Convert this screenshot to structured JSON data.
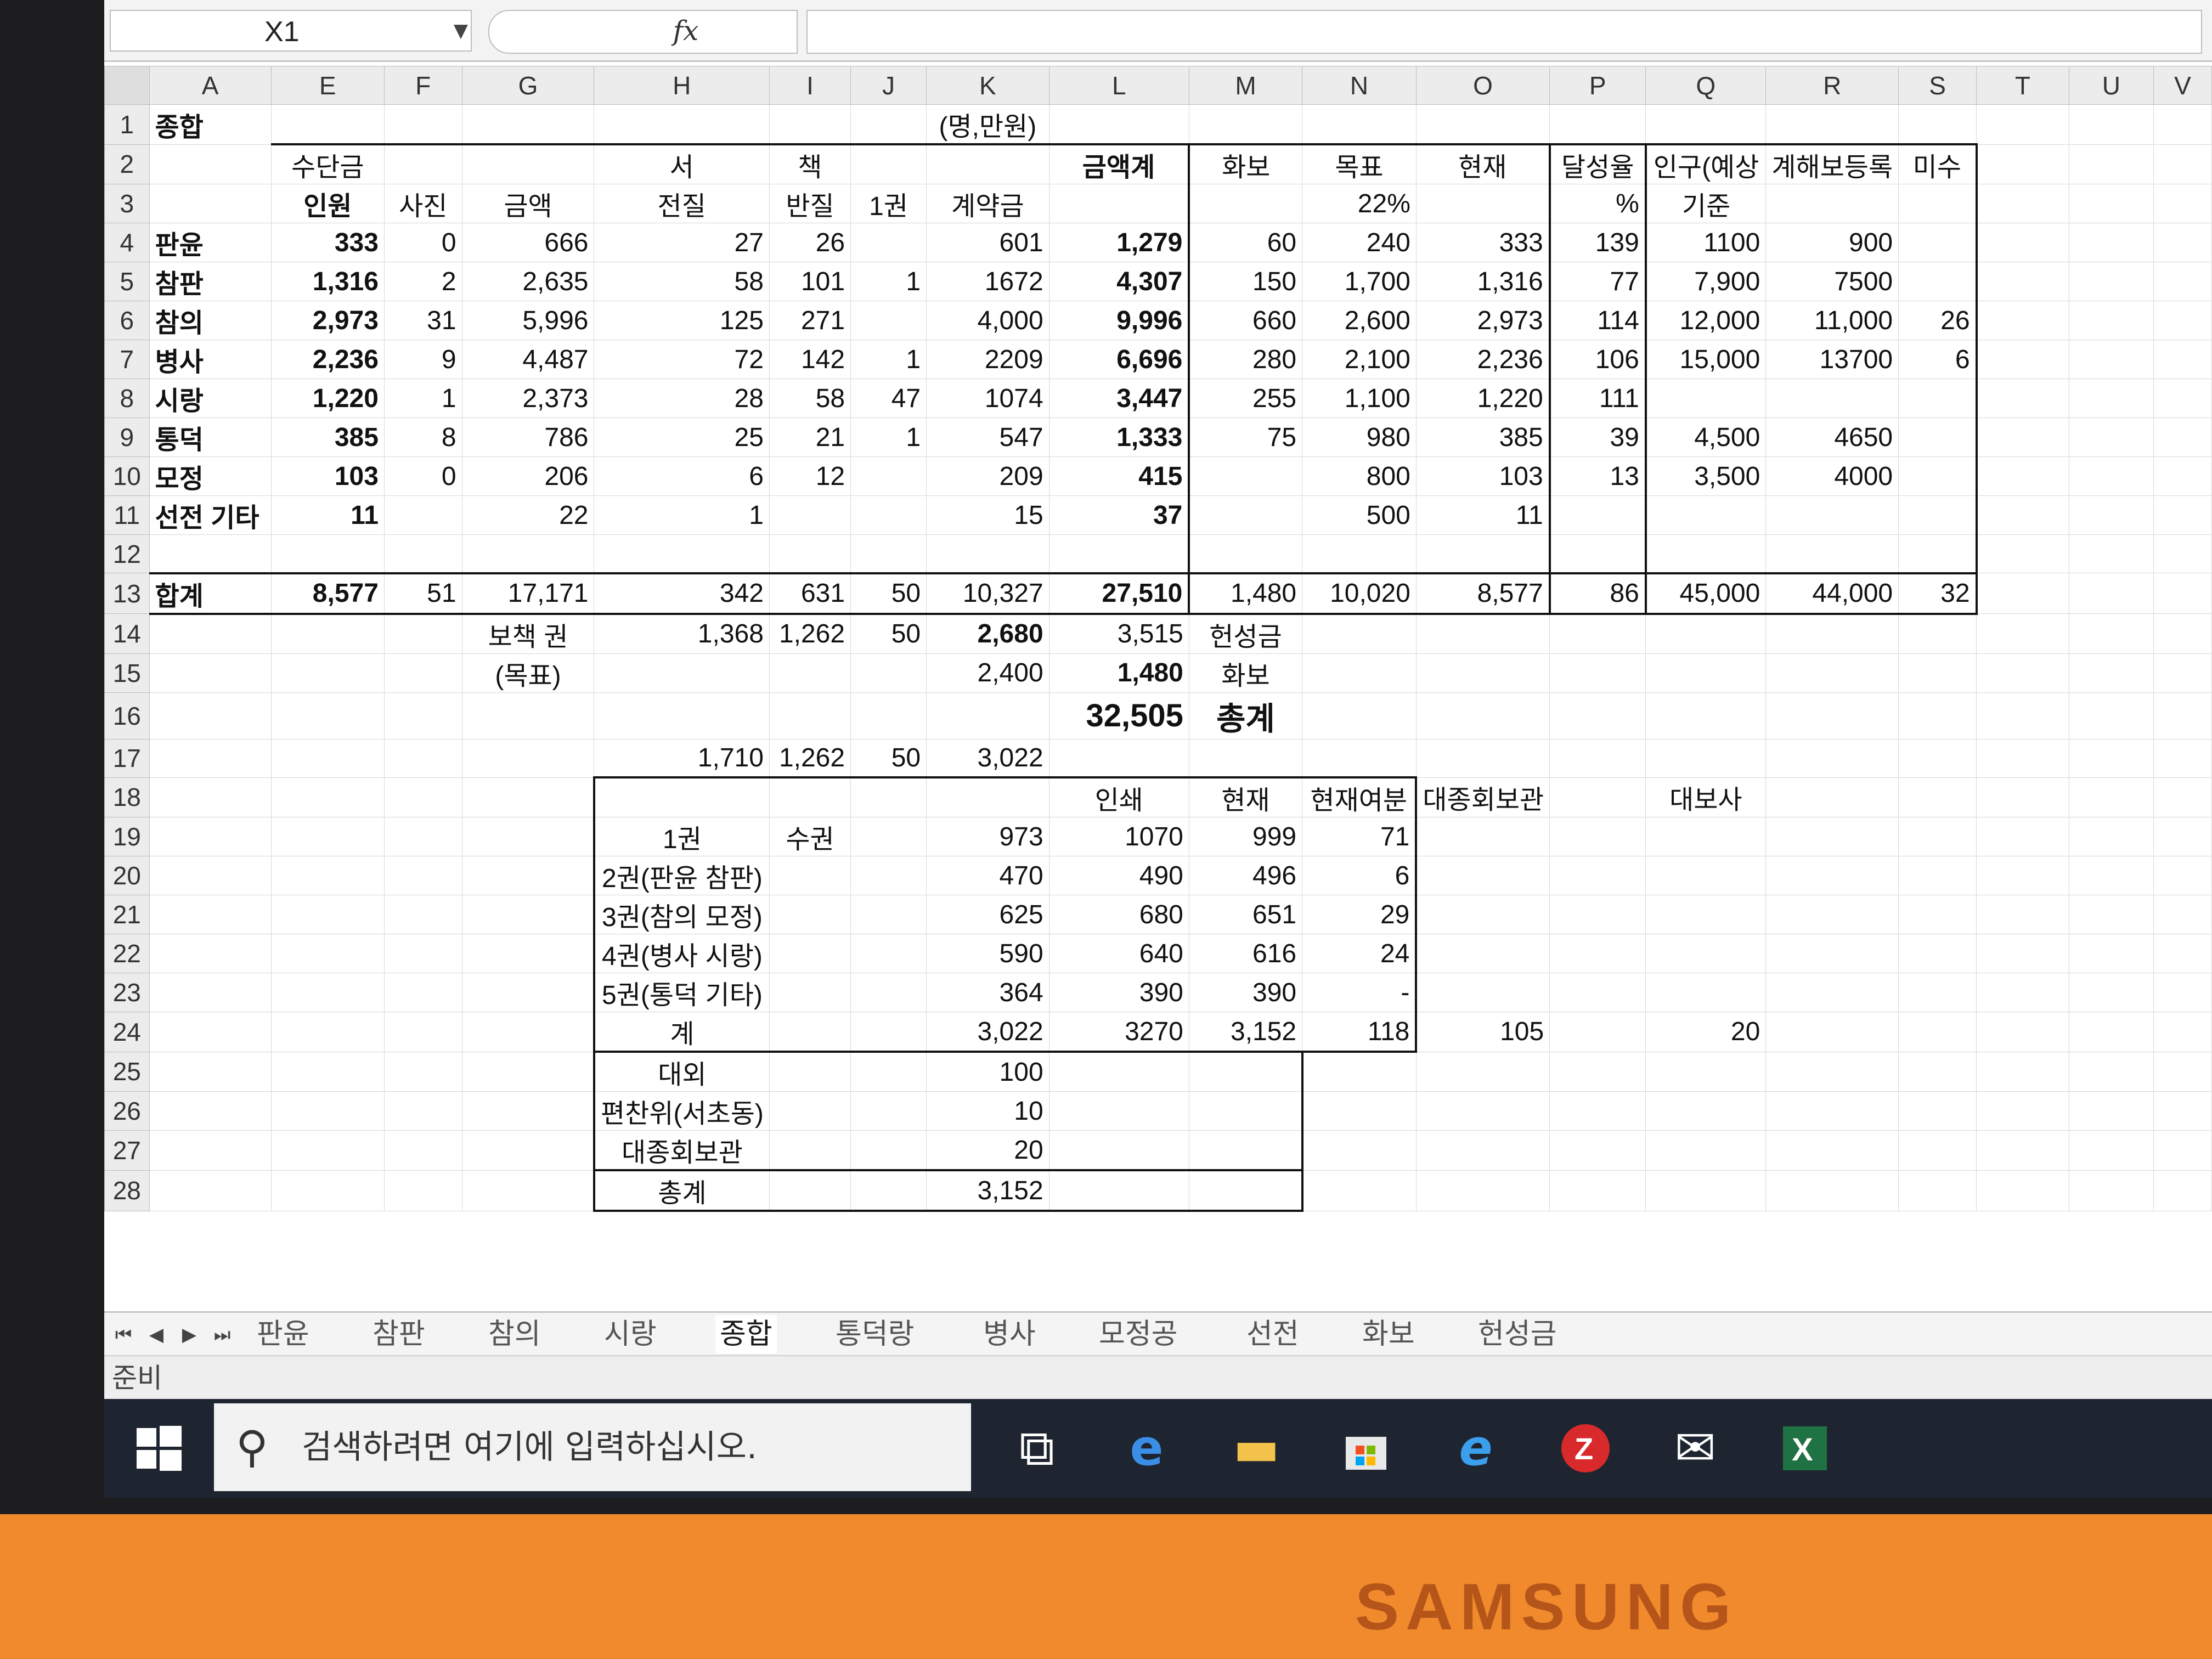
{
  "formula_bar": {
    "name_box": "X1",
    "fx": "fx",
    "formula": ""
  },
  "columns": [
    "A",
    "E",
    "F",
    "G",
    "H",
    "I",
    "J",
    "K",
    "L",
    "M",
    "N",
    "O",
    "P",
    "Q",
    "R",
    "S",
    "T",
    "U",
    "V"
  ],
  "rows": [
    [
      "종합",
      "",
      "",
      "",
      "",
      "",
      "",
      "(명,만원)",
      "",
      "",
      "",
      "",
      "",
      "",
      "",
      "",
      "",
      "",
      ""
    ],
    [
      "",
      "수단금",
      "",
      "",
      "서",
      "책",
      "",
      "",
      "금액계",
      "화보",
      "목표",
      "현재",
      "달성율",
      "인구(예상",
      "계해보등록",
      "미수",
      "",
      "",
      ""
    ],
    [
      "",
      "인원",
      "사진",
      "금액",
      "전질",
      "반질",
      "1권",
      "계약금",
      "",
      "",
      "22%",
      "",
      "%",
      "기준",
      "",
      "",
      "",
      "",
      ""
    ],
    [
      "판윤",
      "333",
      "0",
      "666",
      "27",
      "26",
      "",
      "601",
      "1,279",
      "60",
      "240",
      "333",
      "139",
      "1100",
      "900",
      "",
      "",
      "",
      ""
    ],
    [
      "참판",
      "1,316",
      "2",
      "2,635",
      "58",
      "101",
      "1",
      "1672",
      "4,307",
      "150",
      "1,700",
      "1,316",
      "77",
      "7,900",
      "7500",
      "",
      "",
      "",
      ""
    ],
    [
      "참의",
      "2,973",
      "31",
      "5,996",
      "125",
      "271",
      "",
      "4,000",
      "9,996",
      "660",
      "2,600",
      "2,973",
      "114",
      "12,000",
      "11,000",
      "26",
      "",
      "",
      ""
    ],
    [
      "병사",
      "2,236",
      "9",
      "4,487",
      "72",
      "142",
      "1",
      "2209",
      "6,696",
      "280",
      "2,100",
      "2,236",
      "106",
      "15,000",
      "13700",
      "6",
      "",
      "",
      ""
    ],
    [
      "시랑",
      "1,220",
      "1",
      "2,373",
      "28",
      "58",
      "47",
      "1074",
      "3,447",
      "255",
      "1,100",
      "1,220",
      "111",
      "",
      "",
      "",
      "",
      "",
      ""
    ],
    [
      "통덕",
      "385",
      "8",
      "786",
      "25",
      "21",
      "1",
      "547",
      "1,333",
      "75",
      "980",
      "385",
      "39",
      "4,500",
      "4650",
      "",
      "",
      "",
      ""
    ],
    [
      "모정",
      "103",
      "0",
      "206",
      "6",
      "12",
      "",
      "209",
      "415",
      "",
      "800",
      "103",
      "13",
      "3,500",
      "4000",
      "",
      "",
      "",
      ""
    ],
    [
      "선전 기타",
      "11",
      "",
      "22",
      "1",
      "",
      "",
      "15",
      "37",
      "",
      "500",
      "11",
      "",
      "",
      "",
      "",
      "",
      "",
      ""
    ],
    [
      "",
      "",
      "",
      "",
      "",
      "",
      "",
      "",
      "",
      "",
      "",
      "",
      "",
      "",
      "",
      "",
      "",
      "",
      ""
    ],
    [
      "합계",
      "8,577",
      "51",
      "17,171",
      "342",
      "631",
      "50",
      "10,327",
      "27,510",
      "1,480",
      "10,020",
      "8,577",
      "86",
      "45,000",
      "44,000",
      "32",
      "",
      "",
      ""
    ],
    [
      "",
      "",
      "",
      "보책 권",
      "1,368",
      "1,262",
      "50",
      "2,680",
      "3,515",
      "헌성금",
      "",
      "",
      "",
      "",
      "",
      "",
      "",
      "",
      ""
    ],
    [
      "",
      "",
      "",
      "(목표)",
      "",
      "",
      "",
      "2,400",
      "1,480",
      "화보",
      "",
      "",
      "",
      "",
      "",
      "",
      "",
      "",
      ""
    ],
    [
      "",
      "",
      "",
      "",
      "",
      "",
      "",
      "",
      "32,505",
      "총계",
      "",
      "",
      "",
      "",
      "",
      "",
      "",
      "",
      ""
    ],
    [
      "",
      "",
      "",
      "",
      "1,710",
      "1,262",
      "50",
      "3,022",
      "",
      "",
      "",
      "",
      "",
      "",
      "",
      "",
      "",
      "",
      ""
    ],
    [
      "",
      "",
      "",
      "",
      "",
      "",
      "",
      "",
      "인쇄",
      "현재",
      "현재여분",
      "대종회보관",
      "",
      "대보사",
      "",
      "",
      "",
      "",
      ""
    ],
    [
      "",
      "",
      "",
      "",
      "1권",
      "수권",
      "",
      "973",
      "1070",
      "999",
      "71",
      "",
      "",
      "",
      "",
      "",
      "",
      "",
      ""
    ],
    [
      "",
      "",
      "",
      "",
      "2권(판윤 참판)",
      "",
      "",
      "470",
      "490",
      "496",
      "6",
      "",
      "",
      "",
      "",
      "",
      "",
      "",
      ""
    ],
    [
      "",
      "",
      "",
      "",
      "3권(참의 모정)",
      "",
      "",
      "625",
      "680",
      "651",
      "29",
      "",
      "",
      "",
      "",
      "",
      "",
      "",
      ""
    ],
    [
      "",
      "",
      "",
      "",
      "4권(병사 시랑)",
      "",
      "",
      "590",
      "640",
      "616",
      "24",
      "",
      "",
      "",
      "",
      "",
      "",
      "",
      ""
    ],
    [
      "",
      "",
      "",
      "",
      "5권(통덕 기타)",
      "",
      "",
      "364",
      "390",
      "390",
      "-",
      "",
      "",
      "",
      "",
      "",
      "",
      "",
      ""
    ],
    [
      "",
      "",
      "",
      "",
      "계",
      "",
      "",
      "3,022",
      "3270",
      "3,152",
      "118",
      "105",
      "",
      "20",
      "",
      "",
      "",
      "",
      ""
    ],
    [
      "",
      "",
      "",
      "",
      "대외",
      "",
      "",
      "100",
      "",
      "",
      "",
      "",
      "",
      "",
      "",
      "",
      "",
      "",
      ""
    ],
    [
      "",
      "",
      "",
      "",
      "편찬위(서초동)",
      "",
      "",
      "10",
      "",
      "",
      "",
      "",
      "",
      "",
      "",
      "",
      "",
      "",
      ""
    ],
    [
      "",
      "",
      "",
      "",
      "대종회보관",
      "",
      "",
      "20",
      "",
      "",
      "",
      "",
      "",
      "",
      "",
      "",
      "",
      "",
      ""
    ],
    [
      "",
      "",
      "",
      "",
      "총계",
      "",
      "",
      "3,152",
      "",
      "",
      "",
      "",
      "",
      "",
      "",
      "",
      "",
      "",
      ""
    ]
  ],
  "sheet_tabs": [
    "판윤",
    "참판",
    "참의",
    "시랑",
    "종합",
    "통덕랑",
    "병사",
    "모정공",
    "선전",
    "화보",
    "헌성금"
  ],
  "active_tab": "종합",
  "status": "준비",
  "taskbar": {
    "search_placeholder": "검색하려면 여기에 입력하십시오."
  },
  "brand": "SAMSUNG",
  "colors": {
    "bezel": "#f08a2c",
    "taskbar": "#1f2530",
    "excel_green": "#1f7244"
  }
}
